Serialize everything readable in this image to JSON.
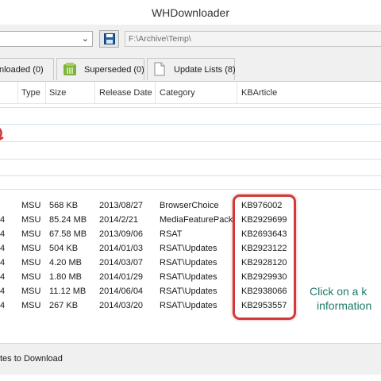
{
  "window": {
    "title": "WHDownloader"
  },
  "toolbar": {
    "combo_value": "",
    "path": "F:\\Archive\\Temp\\",
    "save_icon": "floppy-disk-icon"
  },
  "tabs": [
    {
      "label": "nloaded (0)"
    },
    {
      "label": "Superseded (0)"
    },
    {
      "label": "Update Lists (8)"
    }
  ],
  "columns": [
    "Type",
    "Size",
    "Release Date",
    "Category",
    "KBArticle"
  ],
  "rows": [
    {
      "lead": "",
      "type": "MSU",
      "size": "568 KB",
      "date": "2013/08/27",
      "category": "BrowserChoice",
      "kb": "KB976002"
    },
    {
      "lead": "4",
      "type": "MSU",
      "size": "85.24 MB",
      "date": "2014/2/21",
      "category": "MediaFeaturePack",
      "kb": "KB2929699"
    },
    {
      "lead": "4",
      "type": "MSU",
      "size": "67.58 MB",
      "date": "2013/09/06",
      "category": "RSAT",
      "kb": "KB2693643"
    },
    {
      "lead": "4",
      "type": "MSU",
      "size": "504 KB",
      "date": "2014/01/03",
      "category": "RSAT\\Updates",
      "kb": "KB2923122"
    },
    {
      "lead": "4",
      "type": "MSU",
      "size": "4.20 MB",
      "date": "2014/03/07",
      "category": "RSAT\\Updates",
      "kb": "KB2928120"
    },
    {
      "lead": "4",
      "type": "MSU",
      "size": "1.80 MB",
      "date": "2014/01/29",
      "category": "RSAT\\Updates",
      "kb": "KB2929930"
    },
    {
      "lead": "4",
      "type": "MSU",
      "size": "11.12 MB",
      "date": "2014/06/04",
      "category": "RSAT\\Updates",
      "kb": "KB2938066"
    },
    {
      "lead": "4",
      "type": "MSU",
      "size": "267 KB",
      "date": "2014/03/20",
      "category": "RSAT\\Updates",
      "kb": "KB2953557"
    }
  ],
  "annotation": {
    "line1": "Click on a k",
    "line2": "information"
  },
  "status": {
    "label": "tes to Download"
  },
  "colors": {
    "highlight": "#d03a3a",
    "hint_text": "#1d7a6a",
    "group_line": "#cfe3f2"
  }
}
